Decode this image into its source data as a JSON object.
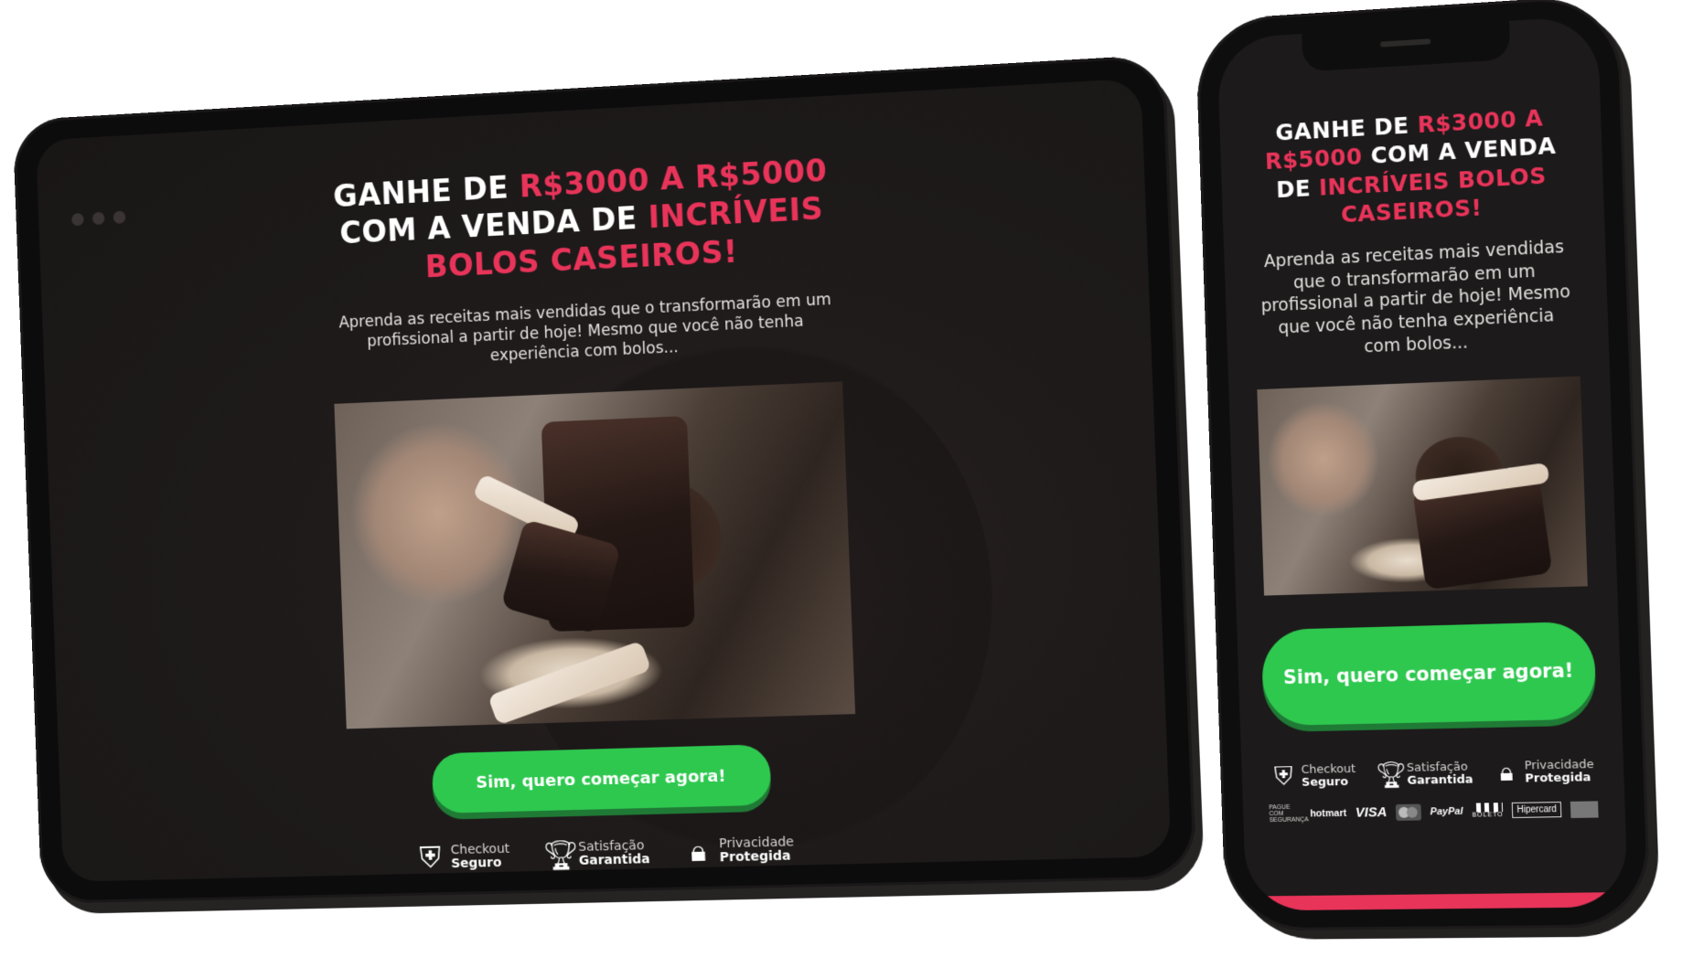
{
  "colors": {
    "accent_red": "#e9345a",
    "cta_green": "#2ec84f",
    "background": "#1c1a1a"
  },
  "headline": {
    "part1": "GANHE DE ",
    "highlight1": "R$3000 A R$5000",
    "part2": " COM A VENDA DE ",
    "highlight2": "INCRÍVEIS BOLOS CASEIROS!"
  },
  "subtitle": "Aprenda as receitas mais vendidas que o transformarão em um profissional a partir de hoje! Mesmo que você não tenha experiência com bolos...",
  "cta_label": "Sim, quero começar agora!",
  "badges": [
    {
      "icon": "shield-check-icon",
      "top": "Checkout",
      "bottom": "Seguro"
    },
    {
      "icon": "trophy-icon",
      "top": "Satisfação",
      "bottom": "Garantida"
    },
    {
      "icon": "lock-icon",
      "top": "Privacidade",
      "bottom": "Protegida"
    }
  ],
  "payments": {
    "safe": "PAGUE COM SEGURANÇA",
    "hotmart": "hotmart",
    "visa": "VISA",
    "mastercard": "mastercard",
    "paypal": "PayPal",
    "boleto": "BOLETO",
    "hipercard": "Hipercard"
  }
}
